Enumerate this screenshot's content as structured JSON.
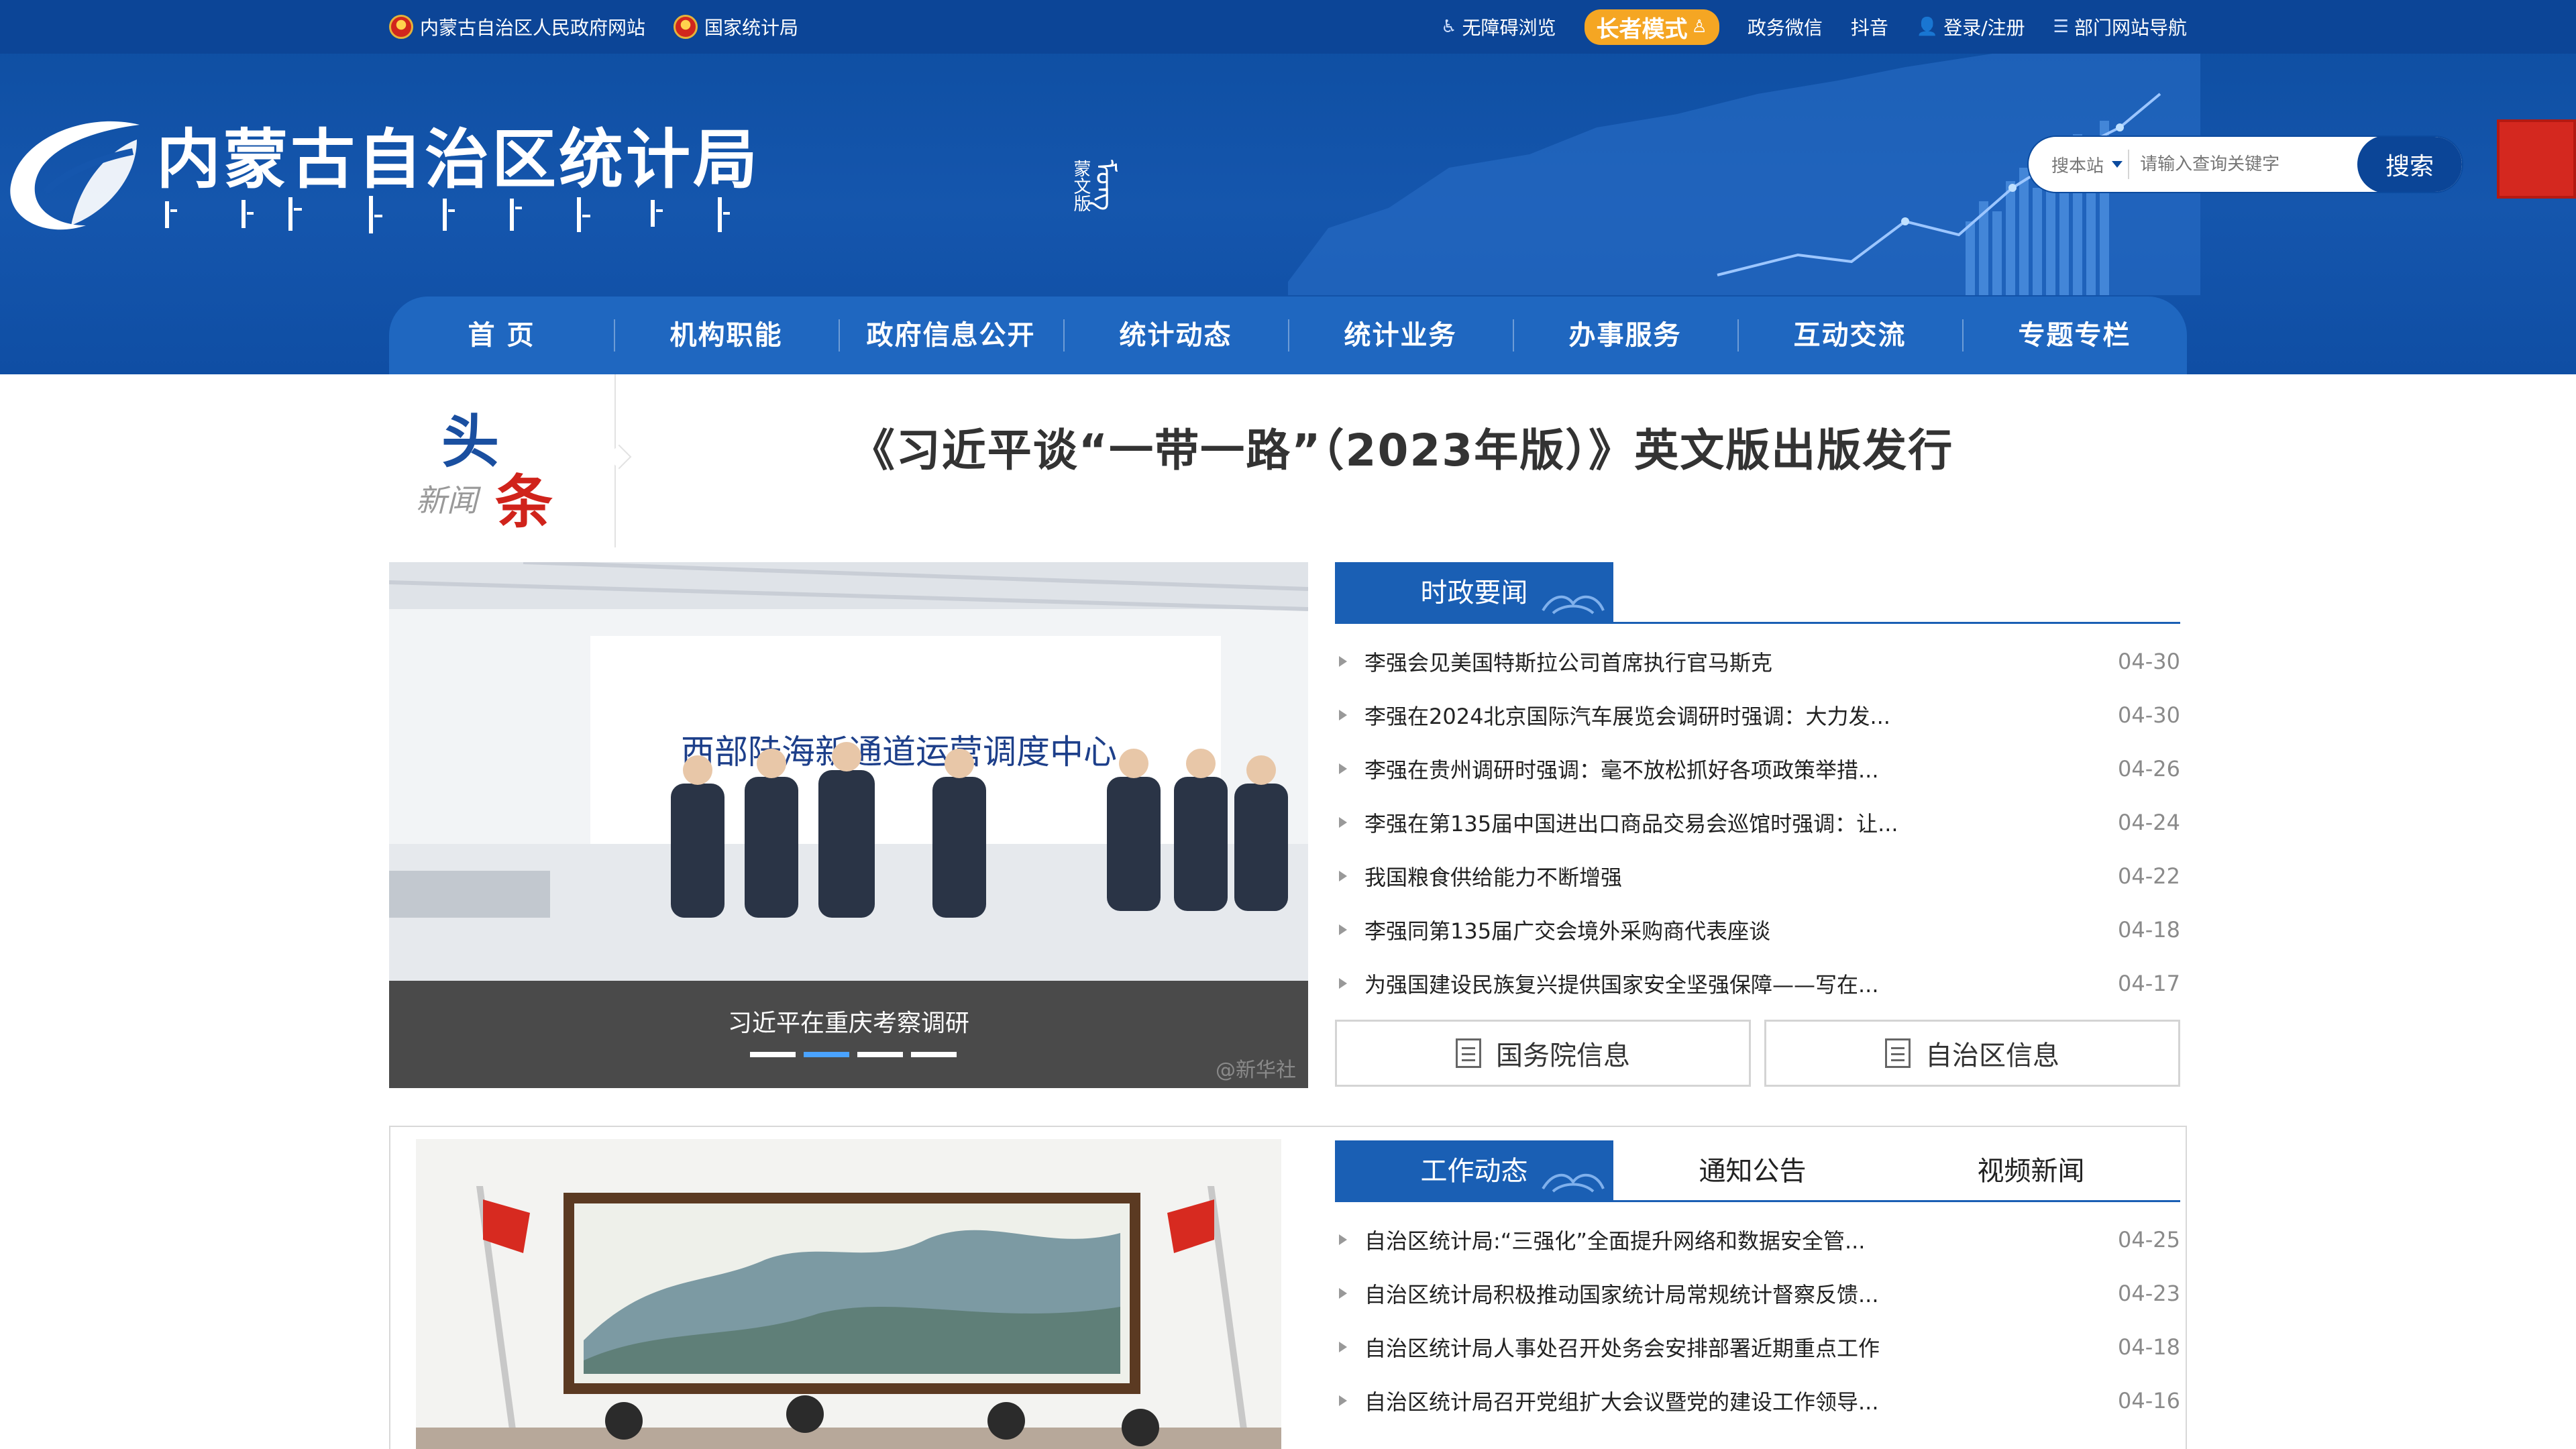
{
  "topbar": {
    "links_left": [
      {
        "label": "内蒙古自治区人民政府网站"
      },
      {
        "label": "国家统计局"
      }
    ],
    "accessibility": "无障碍浏览",
    "elder_mode": "长者模式",
    "wechat": "政务微信",
    "douyin": "抖音",
    "login": "登录/注册",
    "dept_nav": "部门网站导航"
  },
  "header": {
    "site_title": "内蒙古自治区统计局",
    "mongolian_version": [
      "蒙文版",
      "ᠮᠣᠩ"
    ]
  },
  "search": {
    "scope": "搜本站",
    "placeholder": "请输入查询关键字",
    "button": "搜索"
  },
  "nav": {
    "items": [
      "首 页",
      "机构职能",
      "政府信息公开",
      "统计动态",
      "统计业务",
      "办事服务",
      "互动交流",
      "专题专栏"
    ]
  },
  "headline": {
    "badge_top": "头",
    "badge_left": "新闻",
    "badge_right": "条",
    "title": "《习近平谈“一带一路”（2023年版）》英文版出版发行"
  },
  "slider": {
    "caption": "习近平在重庆考察调研",
    "scene_sign": "西部陆海新通道运营调度中心",
    "watermark": "@新华社",
    "dots": 4,
    "active_dot": 1
  },
  "panel1": {
    "tabs": [
      "时政要闻"
    ],
    "items": [
      {
        "title": "李强会见美国特斯拉公司首席执行官马斯克",
        "date": "04-30"
      },
      {
        "title": "李强在2024北京国际汽车展览会调研时强调：大力发...",
        "date": "04-30"
      },
      {
        "title": "李强在贵州调研时强调：毫不放松抓好各项政策举措...",
        "date": "04-26"
      },
      {
        "title": "李强在第135届中国进出口商品交易会巡馆时强调：让...",
        "date": "04-24"
      },
      {
        "title": "我国粮食供给能力不断增强",
        "date": "04-22"
      },
      {
        "title": "李强同第135届广交会境外采购商代表座谈",
        "date": "04-18"
      },
      {
        "title": "为强国建设民族复兴提供国家安全坚强保障——写在...",
        "date": "04-17"
      }
    ]
  },
  "info_buttons": [
    "国务院信息",
    "自治区信息"
  ],
  "panel2": {
    "tabs": [
      "工作动态",
      "通知公告",
      "视频新闻"
    ],
    "items": [
      {
        "title": "自治区统计局:“三强化”全面提升网络和数据安全管...",
        "date": "04-25"
      },
      {
        "title": "自治区统计局积极推动国家统计局常规统计督察反馈...",
        "date": "04-23"
      },
      {
        "title": "自治区统计局人事处召开处务会安排部署近期重点工作",
        "date": "04-18"
      },
      {
        "title": "自治区统计局召开党组扩大会议暨党的建设工作领导...",
        "date": "04-16"
      }
    ]
  },
  "colors": {
    "header_blue": "#1556ad",
    "nav_blue": "#1f67c0",
    "accent_orange": "#f5a623",
    "tab_blue": "#1a5fb4"
  }
}
